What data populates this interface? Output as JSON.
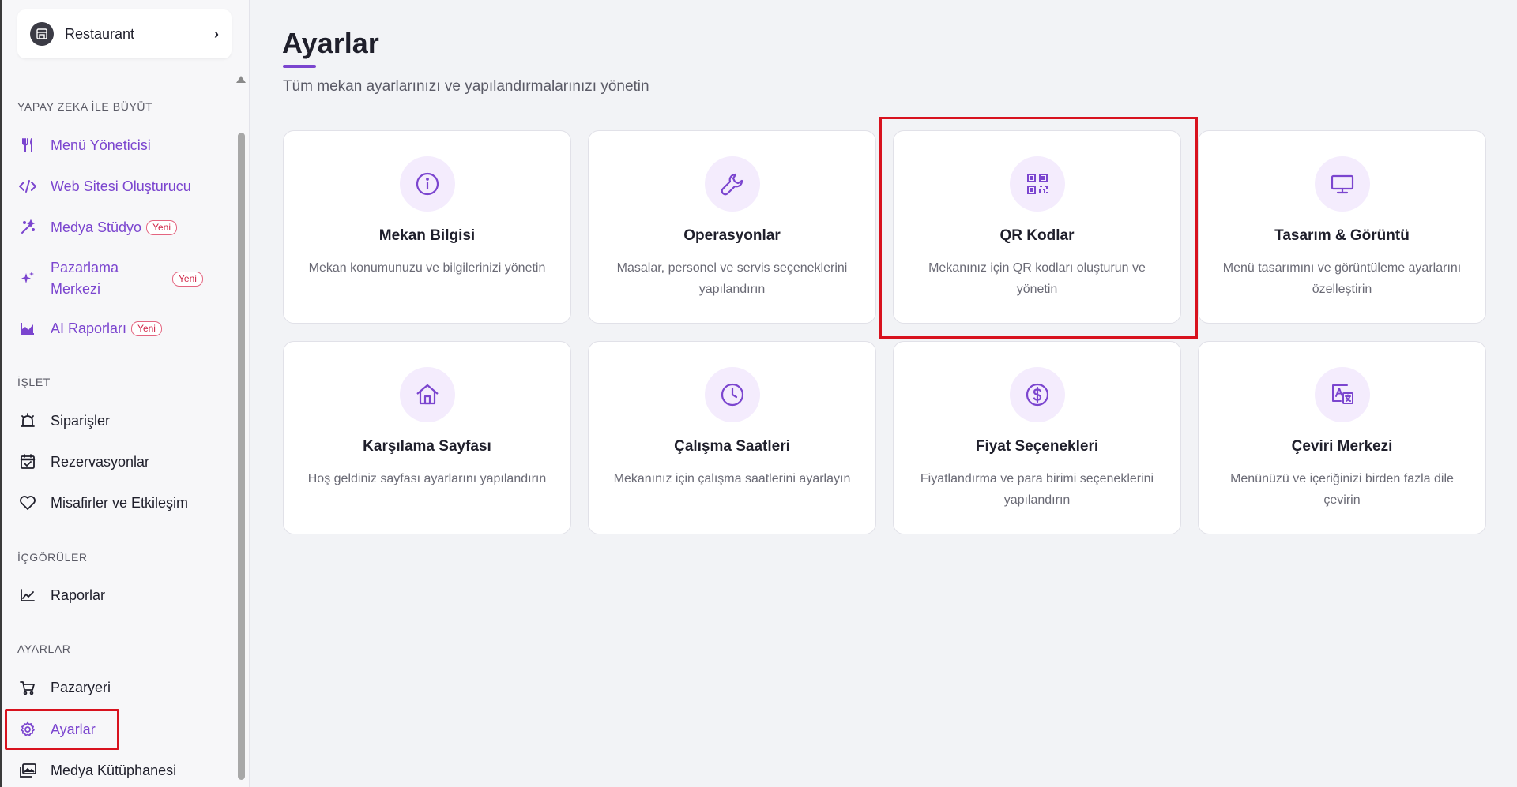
{
  "sidebar": {
    "venue_name": "Restaurant",
    "sections": {
      "ai": "YAPAY ZEKA İLE BÜYÜT",
      "operate": "İŞLET",
      "insights": "İÇGÖRÜLER",
      "settings": "AYARLAR"
    },
    "items": {
      "menu_manager": "Menü Yöneticisi",
      "website_builder": "Web Sitesi Oluşturucu",
      "media_studio": "Medya Stüdyo",
      "marketing_line1": "Pazarlama",
      "marketing_line2": "Merkezi",
      "ai_reports": "AI Raporları",
      "orders": "Siparişler",
      "reservations": "Rezervasyonlar",
      "guests": "Misafirler ve Etkileşim",
      "reports": "Raporlar",
      "marketplace": "Pazaryeri",
      "settings": "Ayarlar",
      "media_library": "Medya Kütüphanesi"
    },
    "new_badge": "Yeni"
  },
  "main": {
    "title": "Ayarlar",
    "subtitle": "Tüm mekan ayarlarınızı ve yapılandırmalarınızı yönetin",
    "cards": [
      {
        "title": "Mekan Bilgisi",
        "desc": "Mekan konumunuzu ve bilgilerinizi yönetin",
        "icon": "info-icon"
      },
      {
        "title": "Operasyonlar",
        "desc": "Masalar, personel ve servis seçeneklerini yapılandırın",
        "icon": "wrench-icon"
      },
      {
        "title": "QR Kodlar",
        "desc": "Mekanınız için QR kodları oluşturun ve yönetin",
        "icon": "qr-code-icon"
      },
      {
        "title": "Tasarım & Görüntü",
        "desc": "Menü tasarımını ve görüntüleme ayarlarını özelleştirin",
        "icon": "monitor-icon"
      },
      {
        "title": "Karşılama Sayfası",
        "desc": "Hoş geldiniz sayfası ayarlarını yapılandırın",
        "icon": "home-icon"
      },
      {
        "title": "Çalışma Saatleri",
        "desc": "Mekanınız için çalışma saatlerini ayarlayın",
        "icon": "clock-icon"
      },
      {
        "title": "Fiyat Seçenekleri",
        "desc": "Fiyatlandırma ve para birimi seçeneklerini yapılandırın",
        "icon": "dollar-icon"
      },
      {
        "title": "Çeviri Merkezi",
        "desc": "Menünüzü ve içeriğinizi birden fazla dile çevirin",
        "icon": "translate-icon"
      }
    ]
  },
  "colors": {
    "accent": "#7b45cf",
    "icon_bg": "#f4ecfd",
    "badge": "#d0284a",
    "highlight": "#d8121e"
  }
}
